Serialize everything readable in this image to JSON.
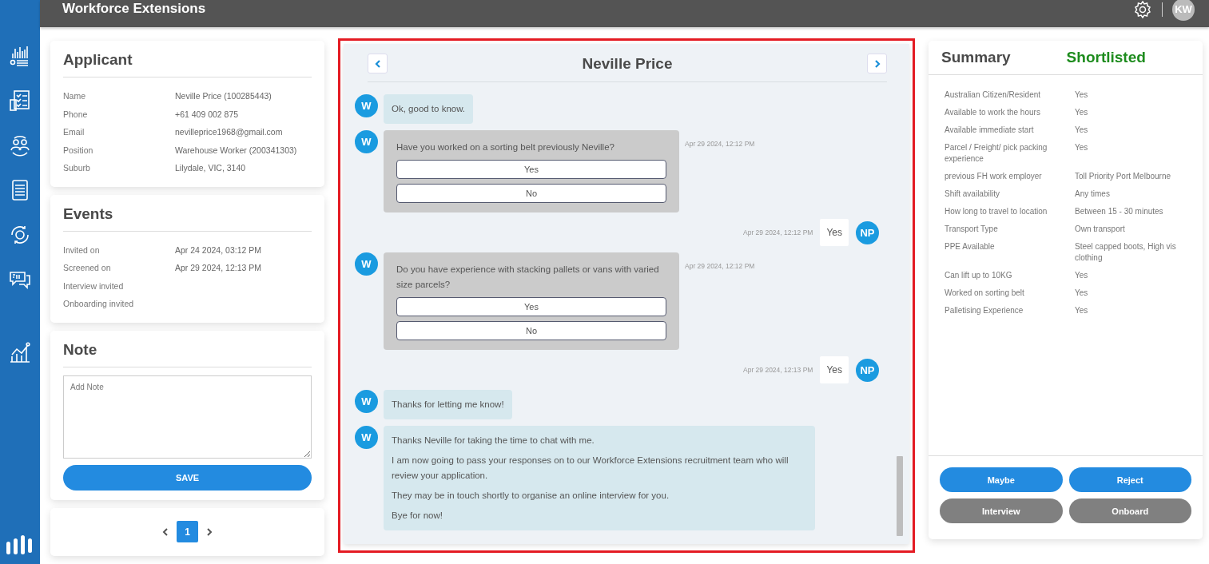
{
  "header": {
    "title": "Workforce Extensions",
    "avatar": "KW"
  },
  "applicant": {
    "title": "Applicant",
    "fields": [
      {
        "label": "Name",
        "value": "Neville Price (100285443)"
      },
      {
        "label": "Phone",
        "value": "+61 409 002 875"
      },
      {
        "label": "Email",
        "value": "nevilleprice1968@gmail.com"
      },
      {
        "label": "Position",
        "value": "Warehouse Worker (200341303)"
      },
      {
        "label": "Suburb",
        "value": "Lilydale, VIC, 3140"
      }
    ]
  },
  "events": {
    "title": "Events",
    "fields": [
      {
        "label": "Invited on",
        "value": "Apr 24 2024, 03:12 PM"
      },
      {
        "label": "Screened on",
        "value": "Apr 29 2024, 12:13 PM"
      },
      {
        "label": "Interview invited"
      },
      {
        "label": "Onboarding invited"
      }
    ]
  },
  "note": {
    "title": "Note",
    "placeholder": "Add Note",
    "button": "SAVE"
  },
  "pager": {
    "pages": [
      {
        "label": "1",
        "selected": true
      }
    ]
  },
  "chat": {
    "title": "Neville Price",
    "messages": [
      {
        "kind": "bot",
        "avatar": "W",
        "lines": [
          "Ok, good to know."
        ]
      },
      {
        "kind": "question",
        "avatar": "W",
        "text": "Have you worked on a sorting belt previously Neville?",
        "options": [
          "Yes",
          "No"
        ],
        "time": "Apr 29 2024, 12:12 PM"
      },
      {
        "kind": "reply",
        "avatar": "NP",
        "text": "Yes",
        "time": "Apr 29 2024, 12:12 PM"
      },
      {
        "kind": "question",
        "avatar": "W",
        "text": "Do you have experience with stacking pallets or vans with varied size parcels?",
        "options": [
          "Yes",
          "No"
        ],
        "time": "Apr 29 2024, 12:12 PM"
      },
      {
        "kind": "reply",
        "avatar": "NP",
        "text": "Yes",
        "time": "Apr 29 2024, 12:13 PM"
      },
      {
        "kind": "bot",
        "avatar": "W",
        "lines": [
          "Thanks for letting me know!"
        ]
      },
      {
        "kind": "bot",
        "avatar": "W",
        "lines": [
          "Thanks Neville for taking the time to chat with me.",
          "I am now going to pass your responses on to our Workforce Extensions recruitment team who will review your application.",
          "They may be in touch shortly to organise an online interview for you.",
          "Bye for now!"
        ]
      }
    ]
  },
  "summary": {
    "title": "Summary",
    "status": "Shortlisted",
    "rows": [
      {
        "label": "Australian Citizen/Resident",
        "value": "Yes"
      },
      {
        "label": "Available to work the hours",
        "value": "Yes"
      },
      {
        "label": "Available immediate start",
        "value": "Yes"
      },
      {
        "label": "Parcel / Freight/ pick packing experience",
        "value": "Yes"
      },
      {
        "label": "previous FH work employer",
        "value": "Toll Priority Port Melbourne"
      },
      {
        "label": "Shift availability",
        "value": "Any times"
      },
      {
        "label": "How long to travel to location",
        "value": "Between 15 - 30 minutes"
      },
      {
        "label": "Transport Type",
        "value": "Own transport"
      },
      {
        "label": "PPE Available",
        "value": "Steel capped boots, High vis clothing"
      },
      {
        "label": "Can lift up to 10KG",
        "value": "Yes"
      },
      {
        "label": "Worked on sorting belt",
        "value": "Yes"
      },
      {
        "label": "Palletising Experience",
        "value": "Yes"
      }
    ],
    "actions": [
      {
        "label": "Maybe",
        "disabled": false
      },
      {
        "label": "Reject",
        "disabled": false
      },
      {
        "label": "Interview",
        "disabled": true
      },
      {
        "label": "Onboard",
        "disabled": true
      }
    ]
  }
}
